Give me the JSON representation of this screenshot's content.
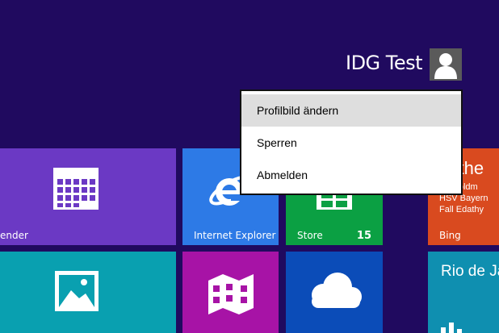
{
  "user": {
    "name": "IDG Test"
  },
  "account_menu": {
    "items": [
      {
        "label": "Profilbild ändern",
        "highlighted": true
      },
      {
        "label": "Sperren",
        "highlighted": false
      },
      {
        "label": "Abmelden",
        "highlighted": false
      }
    ]
  },
  "tiles": {
    "calendar": {
      "label": "ender",
      "color": "#6b39c4"
    },
    "ie": {
      "label": "Internet Explorer",
      "color": "#2d7ae6"
    },
    "store": {
      "label": "Store",
      "badge": "15",
      "color": "#0ba043"
    },
    "bing": {
      "title": "ndthe",
      "lines": [
        "rel Goldm",
        "HSV Bayern",
        "Fall Edathy"
      ],
      "label": "Bing",
      "color": "#d94a1f"
    },
    "photos": {
      "color": "#09a0b0"
    },
    "maps": {
      "color": "#a713a6"
    },
    "skydrive": {
      "color": "#0b4cb8"
    },
    "weather": {
      "title": "Rio de Ja",
      "color": "#0f8fb0"
    }
  },
  "colors": {
    "background": "#200a5f",
    "menu_highlight": "#dedede"
  }
}
